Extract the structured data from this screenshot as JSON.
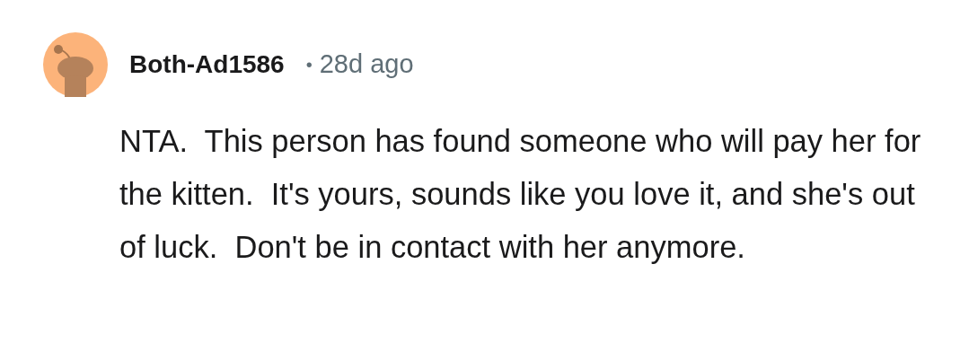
{
  "comment": {
    "author": "Both-Ad1586",
    "separator": "•",
    "time": "28d ago",
    "body": "NTA.  This person has found someone who will pay her for the kitten.  It's yours, sounds like you love it, and she's out of luck.  Don't be in contact with her anymore."
  }
}
